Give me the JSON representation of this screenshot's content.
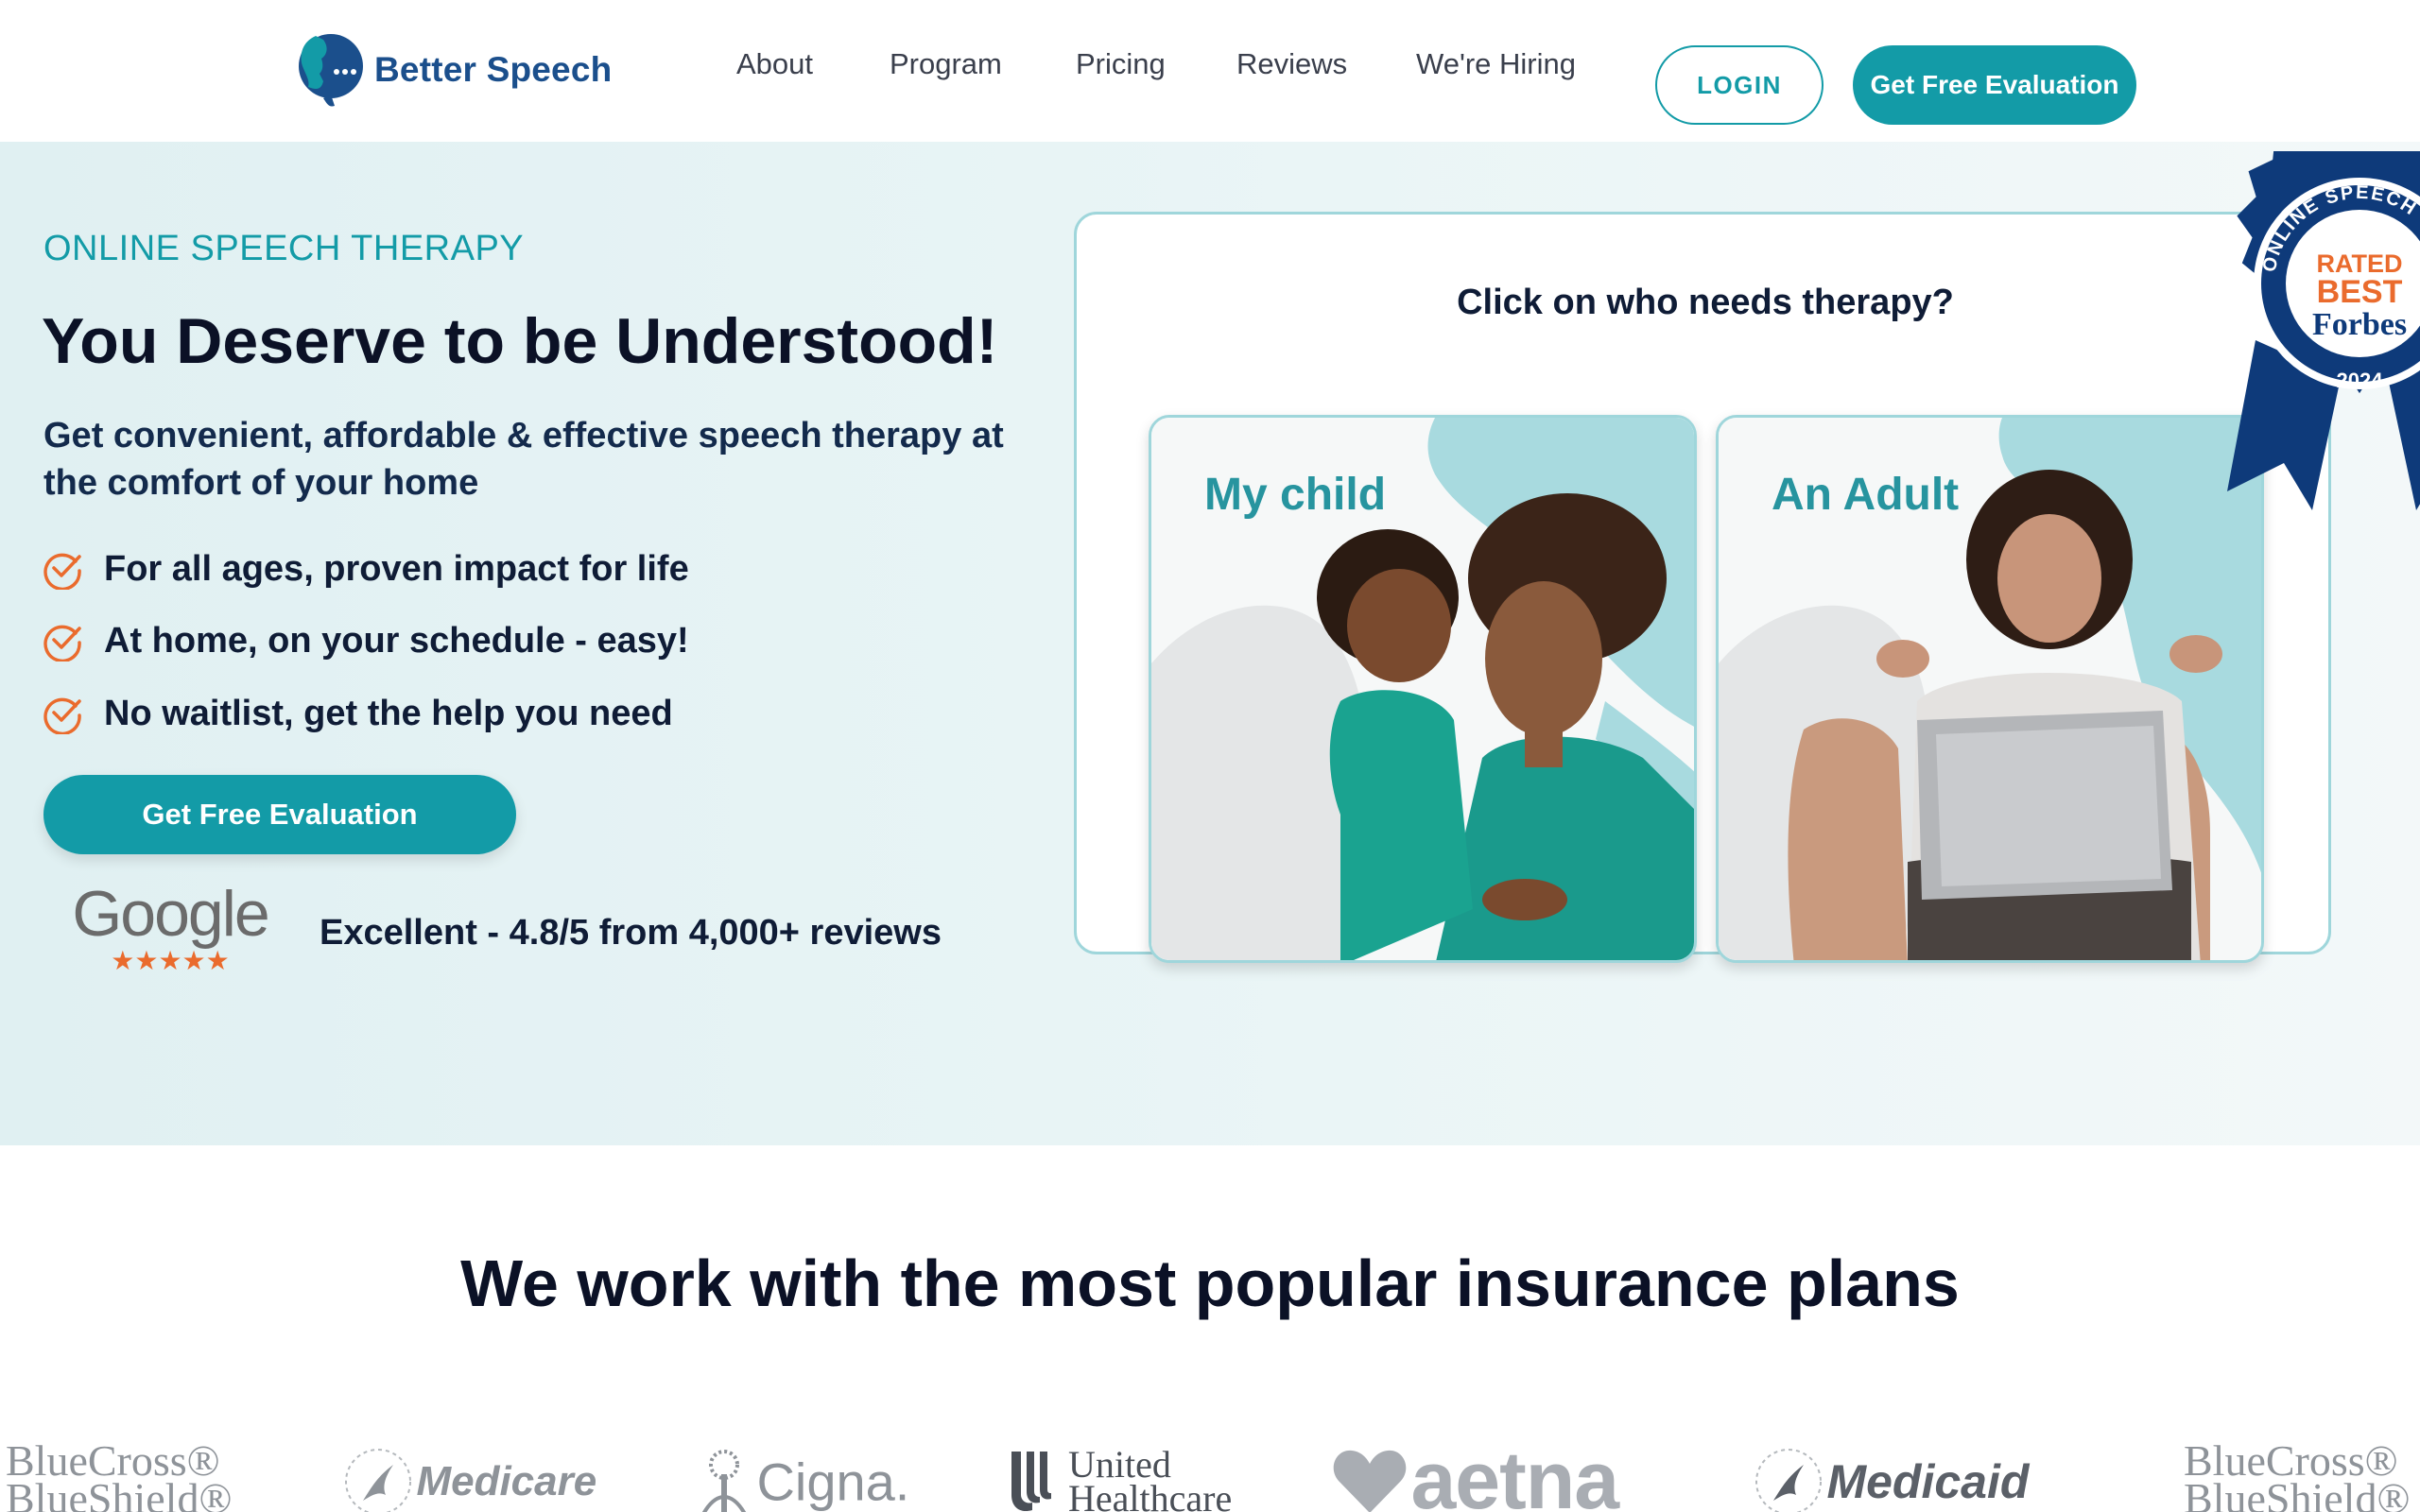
{
  "brand": {
    "name": "Better Speech"
  },
  "nav": {
    "items": [
      {
        "label": "About"
      },
      {
        "label": "Program"
      },
      {
        "label": "Pricing"
      },
      {
        "label": "Reviews"
      },
      {
        "label": "We're Hiring"
      }
    ],
    "login_label": "LOGIN",
    "cta_label": "Get Free Evaluation"
  },
  "hero": {
    "eyebrow": "ONLINE SPEECH THERAPY",
    "title": "You Deserve to be Understood!",
    "subtitle": "Get convenient, affordable & effective speech therapy at the comfort of your home",
    "bullets": [
      "For all ages, proven impact for life",
      "At home, on your schedule - easy!",
      "No waitlist, get the help you need"
    ],
    "cta_label": "Get Free Evaluation",
    "google_word": "Google",
    "google_stars": "★★★★★",
    "rating_value": 4.8,
    "review_text": "Excellent - 4.8/5 from 4,000+ reviews"
  },
  "chooser": {
    "question": "Click on who needs therapy?",
    "options": [
      {
        "label": "My child"
      },
      {
        "label": "An Adult"
      }
    ]
  },
  "badge": {
    "ring_text": "ONLINE SPEECH TH",
    "line1": "RATED",
    "line2": "BEST",
    "line3": "Forbes",
    "year": "2024"
  },
  "insurance": {
    "title": "We work with the most popular insurance plans",
    "logos": [
      {
        "name": "BlueCross BlueShield",
        "line1": "BlueCross®",
        "line2": "BlueShield®"
      },
      {
        "name": "Medicare",
        "line1": "Medicare"
      },
      {
        "name": "Cigna",
        "line1": "Cigna."
      },
      {
        "name": "United Healthcare",
        "line1": "United",
        "line2": "Healthcare"
      },
      {
        "name": "aetna",
        "line1": "aetna"
      },
      {
        "name": "Medicaid",
        "line1": "Medicaid"
      },
      {
        "name": "BlueCross BlueShield",
        "line1": "BlueCross®",
        "line2": "BlueShield®"
      }
    ]
  },
  "colors": {
    "accent": "#139ba7",
    "brand_navy": "#1b4f8c",
    "check_orange": "#ea6b2d",
    "hero_bg": "#e0f0f2",
    "badge_navy": "#0e3a7a"
  }
}
